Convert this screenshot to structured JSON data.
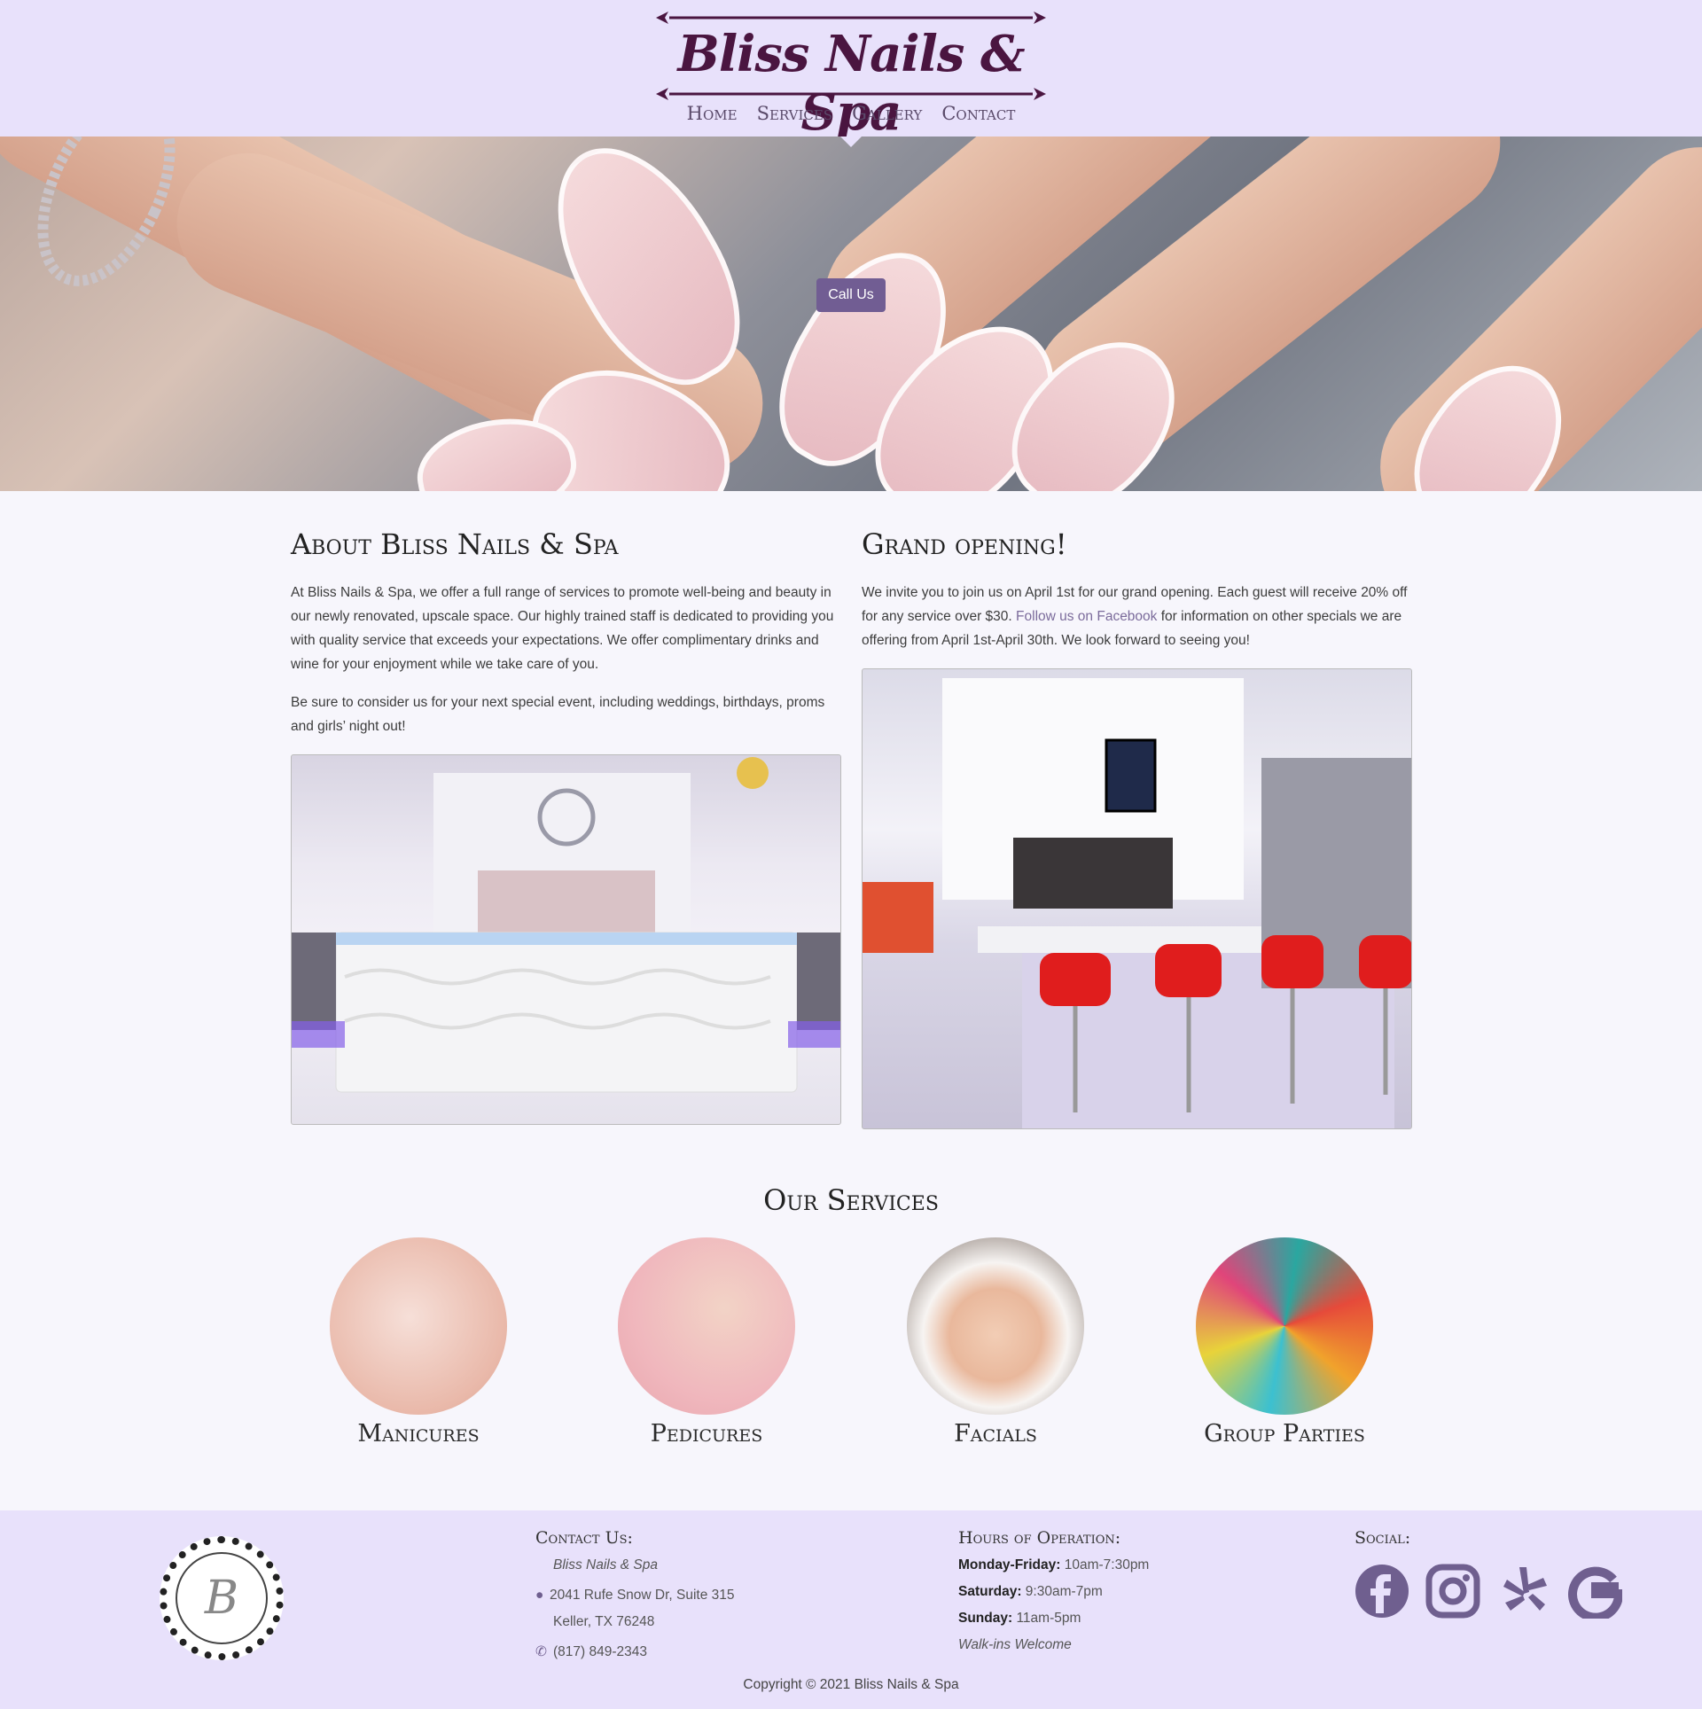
{
  "header": {
    "logo_text": "Bliss Nails & Spa",
    "nav": [
      "Home",
      "Services",
      "Gallery",
      "Contact"
    ]
  },
  "hero": {
    "call_button": "Call Us"
  },
  "about": {
    "title": "About Bliss Nails & Spa",
    "p1": "At Bliss Nails & Spa, we offer a full range of services to promote well-being and beauty in our newly renovated, upscale space. Our highly trained staff is dedicated to providing you with quality service that exceeds your expectations. We offer complimentary drinks and wine for your enjoyment while we take care of you.",
    "p2": "Be sure to consider us for your next special event, including weddings, birthdays, proms and girls’ night out!"
  },
  "grand_opening": {
    "title": "Grand opening!",
    "p_before": "We invite you to join us on April 1st for our grand opening. Each guest will receive 20% off for any service over $30. ",
    "link": "Follow us on Facebook",
    "p_after": " for information on other specials we are offering from April 1st-April 30th. We look forward to seeing you!"
  },
  "services": {
    "title": "Our Services",
    "items": [
      "Manicures",
      "Pedicures",
      "Facials",
      "Group Parties"
    ]
  },
  "footer": {
    "seal_letter": "B",
    "contact": {
      "heading": "Contact Us:",
      "name": "Bliss Nails & Spa",
      "address1": "2041 Rufe Snow Dr, Suite 315",
      "address2": "Keller, TX 76248",
      "phone": "(817) 849-2343"
    },
    "hours": {
      "heading": "Hours of Operation:",
      "weekday_label": "Monday-Friday:",
      "weekday_value": " 10am-7:30pm",
      "saturday_label": "Saturday:",
      "saturday_value": " 9:30am-7pm",
      "sunday_label": "Sunday:",
      "sunday_value": " 11am-5pm",
      "note": "Walk-ins Welcome"
    },
    "social": {
      "heading": "Social:",
      "icons": [
        "facebook-icon",
        "instagram-icon",
        "yelp-icon",
        "google-icon"
      ],
      "color": "#6f5f8f"
    },
    "copyright": "Copyright © 2021 Bliss Nails & Spa"
  },
  "colors": {
    "header_bg": "#e8e1fb",
    "accent": "#715d93",
    "body_bg": "#f7f6fc"
  }
}
